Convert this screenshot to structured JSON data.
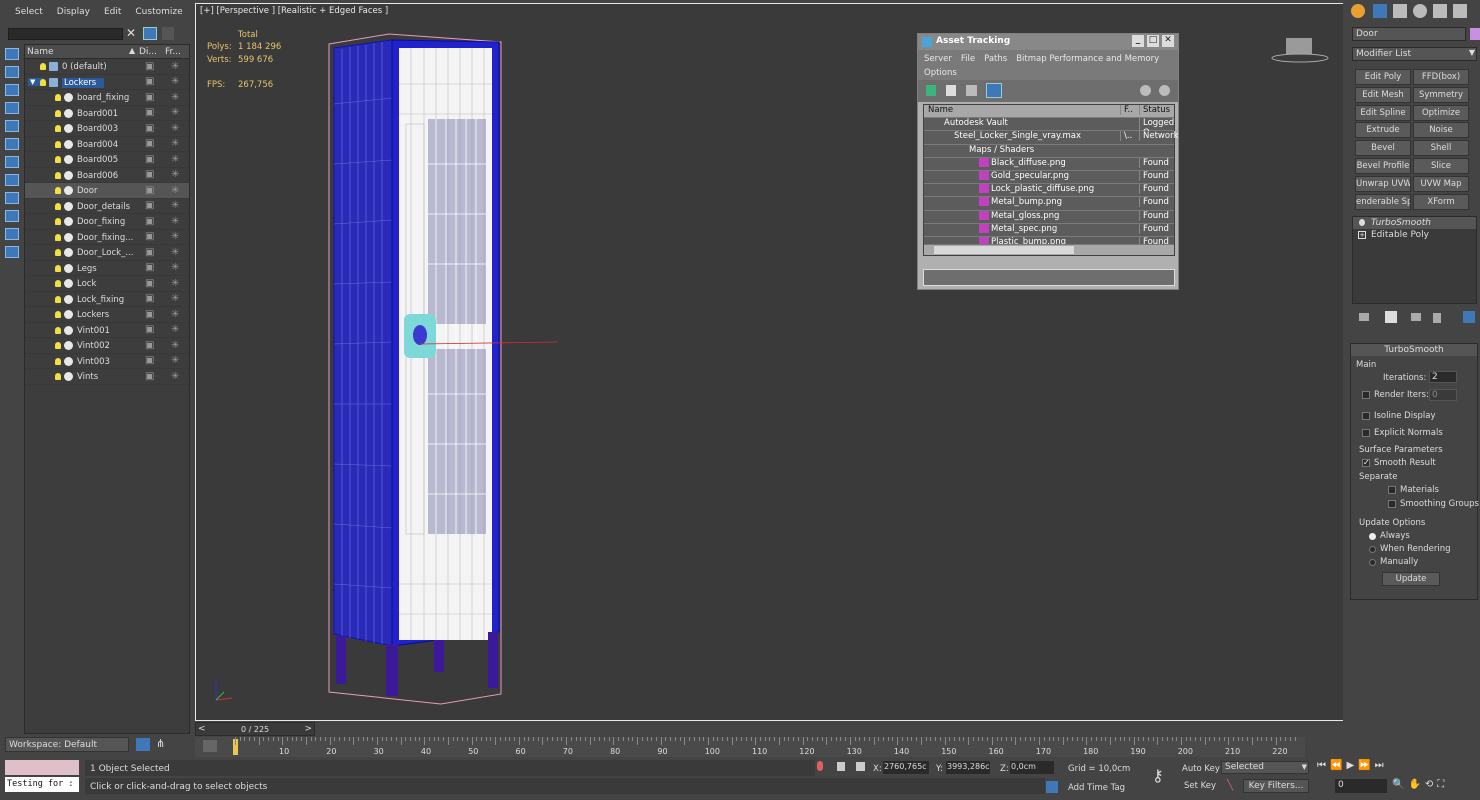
{
  "menu": [
    "Select",
    "Display",
    "Edit",
    "Customize"
  ],
  "explorer": {
    "col_name": "Name",
    "col_display": "Di...",
    "col_freeze": "Fr...",
    "rows": [
      {
        "label": "0 (default)",
        "indent": 0,
        "type": "layer"
      },
      {
        "label": "Lockers",
        "indent": 0,
        "type": "layer",
        "selected": true
      },
      {
        "label": "board_fixing",
        "indent": 1
      },
      {
        "label": "Board001",
        "indent": 1
      },
      {
        "label": "Board003",
        "indent": 1
      },
      {
        "label": "Board004",
        "indent": 1
      },
      {
        "label": "Board005",
        "indent": 1
      },
      {
        "label": "Board006",
        "indent": 1
      },
      {
        "label": "Door",
        "indent": 1,
        "grey": true
      },
      {
        "label": "Door_details",
        "indent": 1
      },
      {
        "label": "Door_fixing",
        "indent": 1
      },
      {
        "label": "Door_fixing...",
        "indent": 1
      },
      {
        "label": "Door_Lock_...",
        "indent": 1
      },
      {
        "label": "Legs",
        "indent": 1
      },
      {
        "label": "Lock",
        "indent": 1
      },
      {
        "label": "Lock_fixing",
        "indent": 1
      },
      {
        "label": "Lockers",
        "indent": 1
      },
      {
        "label": "Vint001",
        "indent": 1
      },
      {
        "label": "Vint002",
        "indent": 1
      },
      {
        "label": "Vint003",
        "indent": 1
      },
      {
        "label": "Vints",
        "indent": 1
      }
    ]
  },
  "workspace": "Workspace: Default",
  "viewport": {
    "label": "[+] [Perspective ] [Realistic + Edged Faces ]",
    "stats": {
      "total": "Total",
      "polys_label": "Polys:",
      "polys": "1 184 296",
      "verts_label": "Verts:",
      "verts": "599 676",
      "fps_label": "FPS:",
      "fps": "267,756"
    }
  },
  "asset": {
    "title": "Asset Tracking",
    "menu": [
      "Server",
      "File",
      "Paths",
      "Bitmap Performance and Memory",
      "Options"
    ],
    "col_name": "Name",
    "col_f": "F..",
    "col_status": "Status",
    "rows": [
      {
        "name": "Autodesk Vault",
        "f": "",
        "status": "Logged O",
        "indent": 20
      },
      {
        "name": "Steel_Locker_Single_vray.max",
        "f": "\\..",
        "status": "Network",
        "indent": 30
      },
      {
        "name": "Maps / Shaders",
        "f": "",
        "status": "",
        "indent": 45
      },
      {
        "name": "Black_diffuse.png",
        "f": "",
        "status": "Found",
        "indent": 55,
        "png": true
      },
      {
        "name": "Gold_specular.png",
        "f": "",
        "status": "Found",
        "indent": 55,
        "png": true
      },
      {
        "name": "Lock_plastic_diffuse.png",
        "f": "",
        "status": "Found",
        "indent": 55,
        "png": true
      },
      {
        "name": "Metal_bump.png",
        "f": "",
        "status": "Found",
        "indent": 55,
        "png": true
      },
      {
        "name": "Metal_gloss.png",
        "f": "",
        "status": "Found",
        "indent": 55,
        "png": true
      },
      {
        "name": "Metal_spec.png",
        "f": "",
        "status": "Found",
        "indent": 55,
        "png": true
      },
      {
        "name": "Plastic_bump.png",
        "f": "",
        "status": "Found",
        "indent": 55,
        "png": true
      }
    ]
  },
  "cmd": {
    "object_name": "Door",
    "modifier_list": "Modifier List",
    "buttons": [
      "Edit Poly",
      "FFD(box)",
      "Edit Mesh",
      "Symmetry",
      "Edit Spline",
      "Optimize",
      "Extrude",
      "Noise",
      "Bevel",
      "Shell",
      "Bevel Profile",
      "Slice",
      "Unwrap UVW",
      "UVW Map",
      "enderable Splin",
      "XForm"
    ],
    "stack": [
      "TurboSmooth",
      "Editable Poly"
    ],
    "rollout": "TurboSmooth",
    "main": "Main",
    "iterations_label": "Iterations:",
    "iterations": "2",
    "render_iters_label": "Render Iters:",
    "render_iters": "0",
    "isoline": "Isoline Display",
    "explicit": "Explicit Normals",
    "surface": "Surface Parameters",
    "smooth_result": "Smooth Result",
    "separate": "Separate",
    "materials": "Materials",
    "smoothing_groups": "Smoothing Groups",
    "update_options": "Update Options",
    "always": "Always",
    "when_rendering": "When Rendering",
    "manually": "Manually",
    "update": "Update"
  },
  "timeline": {
    "counter": "0 / 225",
    "ticks": [
      "10",
      "20",
      "30",
      "40",
      "50",
      "60",
      "70",
      "80",
      "90",
      "100",
      "110",
      "120",
      "130",
      "140",
      "150",
      "160",
      "170",
      "180",
      "190",
      "200",
      "210",
      "220"
    ]
  },
  "status": {
    "script": "Testing for :",
    "selected": "1 Object Selected",
    "prompt": "Click or click-and-drag to select objects",
    "x_label": "X:",
    "x": "2760,765c",
    "y_label": "Y:",
    "y": "3993,286c",
    "z_label": "Z:",
    "z": "0,0cm",
    "grid": "Grid = 10,0cm",
    "auto_key": "Auto Key",
    "set_key": "Set Key",
    "key_mode": "Selected",
    "key_filters": "Key Filters...",
    "add_time_tag": "Add Time Tag",
    "frame": "0"
  }
}
